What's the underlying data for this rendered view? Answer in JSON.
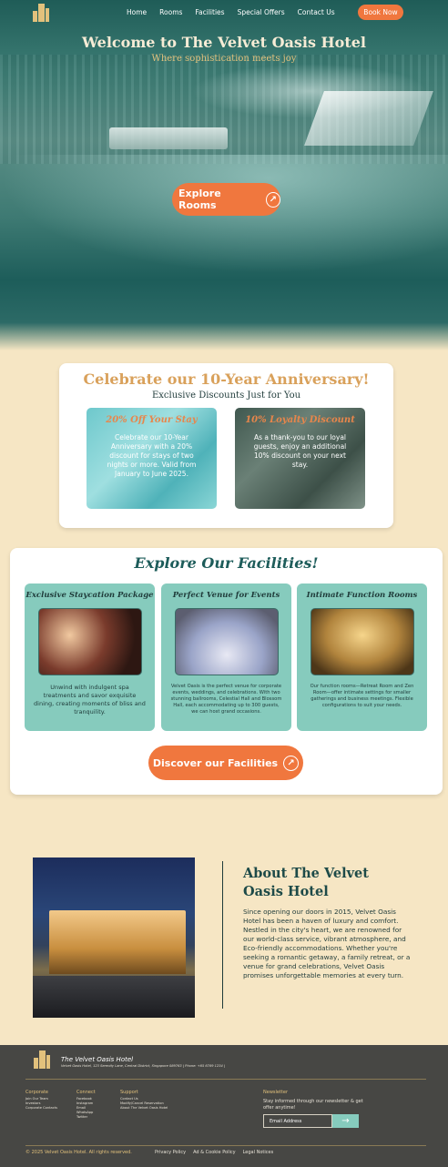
{
  "nav": {
    "links": [
      "Home",
      "Rooms",
      "Facilities",
      "Special Offers",
      "Contact Us"
    ],
    "book_label": "Book Now"
  },
  "hero": {
    "title": "Welcome to The Velvet Oasis Hotel",
    "subtitle": "Where sophistication meets joy",
    "explore_label": "Explore Rooms"
  },
  "anniversary": {
    "title": "Celebrate our  10-Year Anniversary!",
    "subtitle": "Exclusive Discounts Just for You",
    "offers": [
      {
        "title": "20% Off Your Stay",
        "text": "Celebrate our 10-Year Anniversary with a 20% discount for stays of two nights or more. Valid from January to June 2025."
      },
      {
        "title": "10% Loyalty Discount",
        "text": "As a thank-you to our loyal guests, enjoy an additional 10% discount on your next stay."
      }
    ]
  },
  "facilities": {
    "title": "Explore Our Facilities!",
    "cards": [
      {
        "title": "Exclusive Staycation Package",
        "text": "Unwind with indulgent spa treatments and savor exquisite dining, creating moments of bliss and tranquility."
      },
      {
        "title": "Perfect Venue for Events",
        "text": "Velvet Oasis is the perfect venue for corporate events, weddings, and celebrations. With two stunning ballrooms, Celestial Hall and Blossom Hall, each accommodating up to 300 guests, we can host grand occasions."
      },
      {
        "title": "Intimate Function Rooms",
        "text": "Our function rooms—Retreat Room and Zen Room—offer intimate settings for smaller gatherings and business meetings. Flexible configurations to suit your needs."
      }
    ],
    "discover_label": "Discover our Facilities"
  },
  "about": {
    "title": "About The Velvet Oasis Hotel",
    "text": "Since opening our doors in 2015, Velvet Oasis Hotel has been a haven of luxury and comfort. Nestled in the city's heart, we are renowned for our world-class service, vibrant atmosphere, and Eco-friendly accommodations. Whether you're seeking a romantic getaway, a family retreat, or a venue for grand celebrations, Velvet Oasis promises unforgettable memories at every turn."
  },
  "footer": {
    "name": "The Velvet Oasis Hotel",
    "address": "Velvet Oasis Hotel, 123 Serenity Lane, Central District, Singapore 089763 | Phone: +65 6789 1234 |",
    "columns": [
      {
        "heading": "Corporate",
        "items": [
          "Join Our Team",
          "Investors",
          "Corporate Contacts"
        ]
      },
      {
        "heading": "Connect",
        "items": [
          "Facebook",
          "Instagram",
          "Email",
          "WhatsApp",
          "Twitter"
        ]
      },
      {
        "heading": "Support",
        "items": [
          "Contact Us",
          "Modify/Cancel Reservation",
          "About The Velvet Oasis Hotel"
        ]
      }
    ],
    "newsletter_heading": "Newsletter",
    "newsletter_text": "Stay informed through our newsletter & get offer anytime!",
    "email_placeholder": "Email Address",
    "copyright": "© 2025 Velvet Oasis Hotel. All rights reserved.",
    "legal": [
      "Privacy Policy",
      "Ad & Cookie Policy",
      "Legal Notices"
    ]
  },
  "colors": {
    "accent": "#f0773e",
    "teal": "#1d5c5a",
    "card": "#86cbbd",
    "gold": "#e2c17c"
  }
}
